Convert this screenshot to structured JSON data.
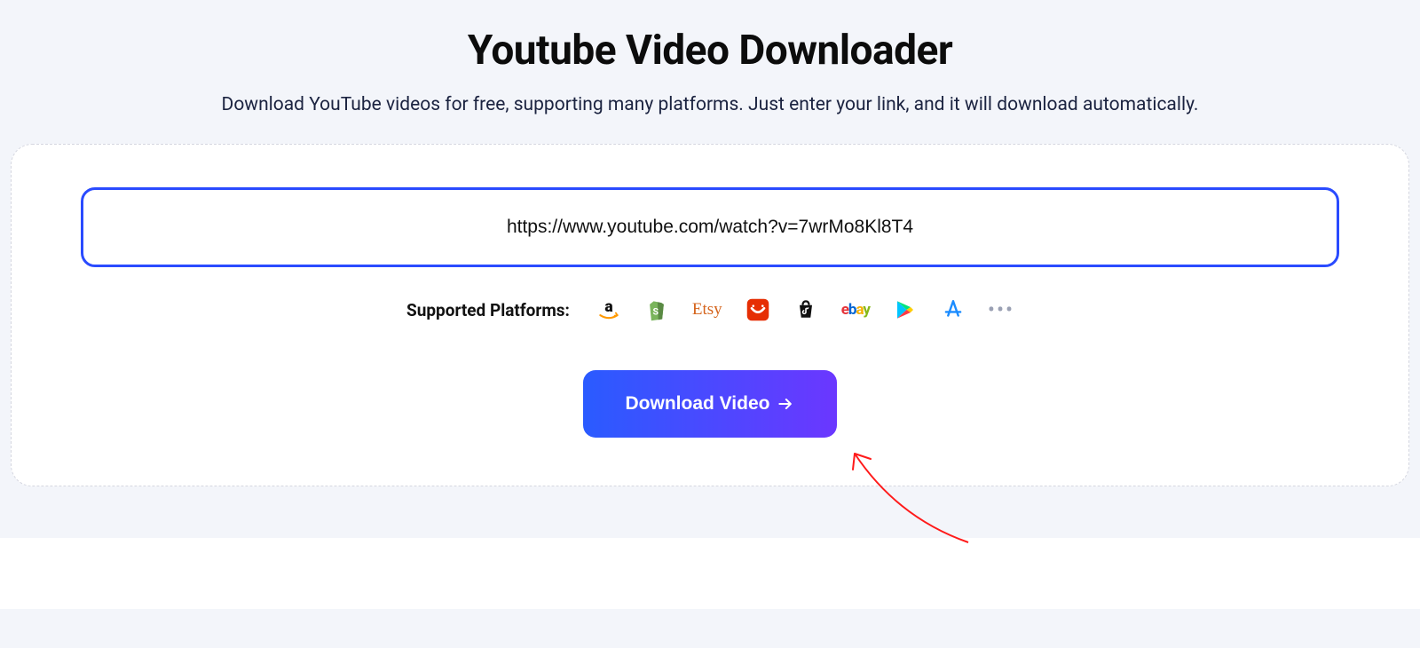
{
  "header": {
    "title": "Youtube Video Downloader",
    "subtitle": "Download YouTube videos for free, supporting many platforms. Just enter your link, and it will download automatically."
  },
  "form": {
    "url_value": "https://www.youtube.com/watch?v=7wrMo8Kl8T4",
    "platforms_label": "Supported Platforms:",
    "download_label": "Download Video"
  },
  "platforms": [
    {
      "name": "amazon"
    },
    {
      "name": "shopify"
    },
    {
      "name": "etsy"
    },
    {
      "name": "aliexpress"
    },
    {
      "name": "tiktok-shop"
    },
    {
      "name": "ebay"
    },
    {
      "name": "google-play"
    },
    {
      "name": "app-store"
    }
  ],
  "colors": {
    "accent": "#2a4bff",
    "gradient_end": "#6b37ff",
    "annotation": "#ff1a1a"
  }
}
